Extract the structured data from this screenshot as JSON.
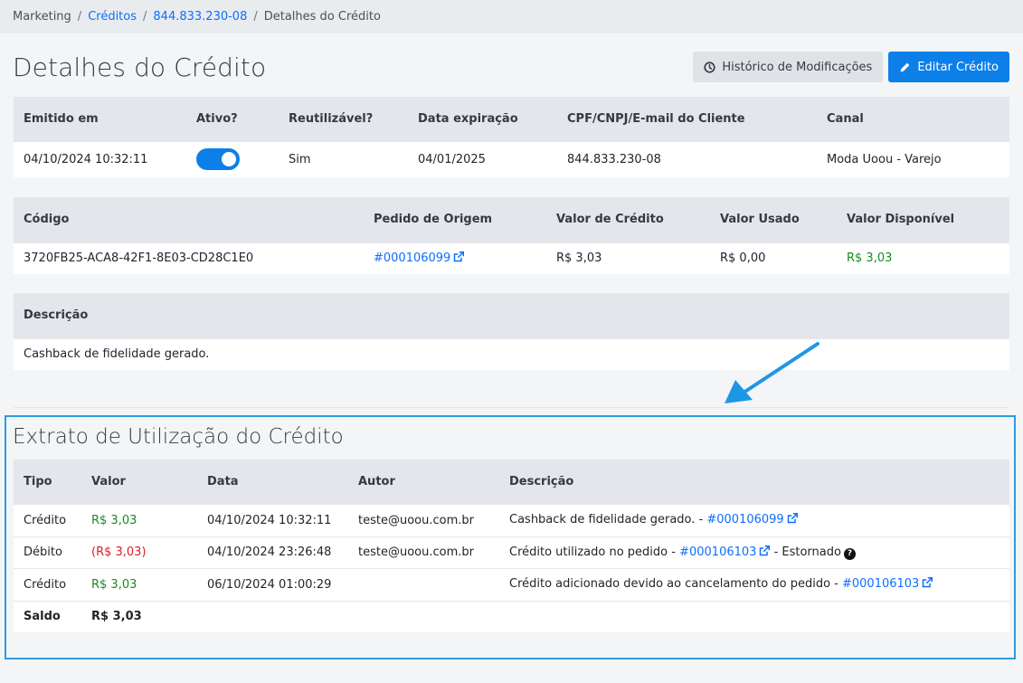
{
  "breadcrumb": {
    "items": [
      {
        "label": "Marketing",
        "link": false
      },
      {
        "label": "Créditos",
        "link": true
      },
      {
        "label": "844.833.230-08",
        "link": true
      },
      {
        "label": "Detalhes do Crédito",
        "link": false
      }
    ]
  },
  "header": {
    "title": "Detalhes do Crédito",
    "history_label": "Histórico de Modificações",
    "edit_label": "Editar Crédito"
  },
  "info": {
    "headers": [
      "Emitido em",
      "Ativo?",
      "Reutilizável?",
      "Data expiração",
      "CPF/CNPJ/E-mail do Cliente",
      "Canal"
    ],
    "emitido": "04/10/2024 10:32:11",
    "ativo": true,
    "reutilizavel": "Sim",
    "expiracao": "04/01/2025",
    "cliente": "844.833.230-08",
    "canal": "Moda Uoou - Varejo"
  },
  "codigo": {
    "headers": [
      "Código",
      "Pedido de Origem",
      "Valor de Crédito",
      "Valor Usado",
      "Valor Disponível"
    ],
    "codigo": "3720FB25-ACA8-42F1-8E03-CD28C1E0",
    "pedido": "#000106099",
    "valor_credito": "R$ 3,03",
    "valor_usado": "R$ 0,00",
    "valor_disponivel": "R$ 3,03"
  },
  "descricao": {
    "header": "Descrição",
    "text": "Cashback de fidelidade gerado."
  },
  "extrato": {
    "title": "Extrato de Utilização do Crédito",
    "headers": [
      "Tipo",
      "Valor",
      "Data",
      "Autor",
      "Descrição"
    ],
    "rows": [
      {
        "tipo": "Crédito",
        "valor": "R$ 3,03",
        "data": "04/10/2024 10:32:11",
        "autor": "teste@uoou.com.br",
        "desc": "Cashback de fidelidade gerado. - ",
        "pedido": "#000106099",
        "suffix": ""
      },
      {
        "tipo": "Débito",
        "valor": "(R$ 3,03)",
        "data": "04/10/2024 23:26:48",
        "autor": "teste@uoou.com.br",
        "desc": "Crédito utilizado no pedido - ",
        "pedido": "#000106103",
        "suffix": " - Estornado"
      },
      {
        "tipo": "Crédito",
        "valor": "R$ 3,03",
        "data": "06/10/2024 01:00:29",
        "autor": "",
        "desc": "Crédito adicionado devido ao cancelamento do pedido - ",
        "pedido": "#000106103",
        "suffix": ""
      }
    ],
    "saldo_label": "Saldo",
    "saldo_value": "R$ 3,03"
  },
  "colors": {
    "primary": "#0d7fe8",
    "positive": "#198a1e",
    "negative": "#dc1c2c",
    "highlight": "#2a9ee0"
  },
  "icons": [
    "clock-icon",
    "pencil-icon",
    "external-link-icon",
    "question-icon",
    "arrow-annotation"
  ]
}
